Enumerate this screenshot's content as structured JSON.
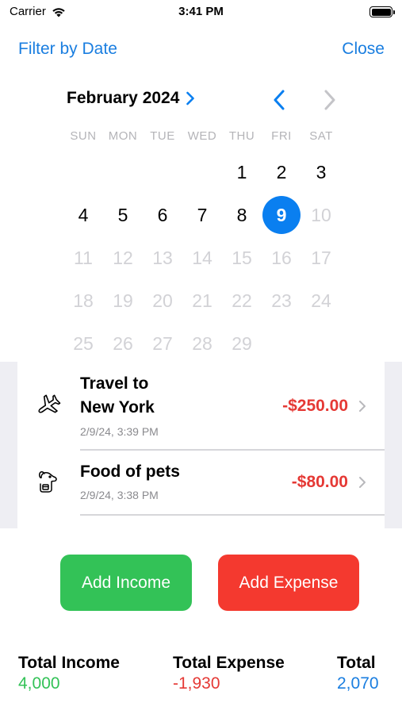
{
  "status_bar": {
    "carrier": "Carrier",
    "time": "3:41 PM"
  },
  "nav": {
    "left": "Filter by Date",
    "right": "Close"
  },
  "calendar": {
    "month_label": "February 2024",
    "weekdays": [
      "SUN",
      "MON",
      "TUE",
      "WED",
      "THU",
      "FRI",
      "SAT"
    ],
    "days": [
      {
        "label": "",
        "state": "empty"
      },
      {
        "label": "",
        "state": "empty"
      },
      {
        "label": "",
        "state": "empty"
      },
      {
        "label": "",
        "state": "empty"
      },
      {
        "label": "1",
        "state": "enabled"
      },
      {
        "label": "2",
        "state": "enabled"
      },
      {
        "label": "3",
        "state": "enabled"
      },
      {
        "label": "4",
        "state": "enabled"
      },
      {
        "label": "5",
        "state": "enabled"
      },
      {
        "label": "6",
        "state": "enabled"
      },
      {
        "label": "7",
        "state": "enabled"
      },
      {
        "label": "8",
        "state": "enabled"
      },
      {
        "label": "9",
        "state": "selected"
      },
      {
        "label": "10",
        "state": "disabled"
      },
      {
        "label": "11",
        "state": "disabled"
      },
      {
        "label": "12",
        "state": "disabled"
      },
      {
        "label": "13",
        "state": "disabled"
      },
      {
        "label": "14",
        "state": "disabled"
      },
      {
        "label": "15",
        "state": "disabled"
      },
      {
        "label": "16",
        "state": "disabled"
      },
      {
        "label": "17",
        "state": "disabled"
      },
      {
        "label": "18",
        "state": "disabled"
      },
      {
        "label": "19",
        "state": "disabled"
      },
      {
        "label": "20",
        "state": "disabled"
      },
      {
        "label": "21",
        "state": "disabled"
      },
      {
        "label": "22",
        "state": "disabled"
      },
      {
        "label": "23",
        "state": "disabled"
      },
      {
        "label": "24",
        "state": "disabled"
      },
      {
        "label": "25",
        "state": "disabled"
      },
      {
        "label": "26",
        "state": "disabled"
      },
      {
        "label": "27",
        "state": "disabled"
      },
      {
        "label": "28",
        "state": "disabled"
      },
      {
        "label": "29",
        "state": "disabled"
      }
    ]
  },
  "transactions": [
    {
      "title_line1": "Travel to",
      "title_line2": "New York",
      "timestamp": "2/9/24, 3:39 PM",
      "amount": "-$250.00",
      "icon": "airplane-icon"
    },
    {
      "title_line1": "Food of pets",
      "timestamp": "2/9/24, 3:38 PM",
      "amount": "-$80.00",
      "icon": "pet-icon"
    }
  ],
  "buttons": {
    "add_income": "Add Income",
    "add_expense": "Add Expense"
  },
  "totals": {
    "income_label": "Total Income",
    "income_value": "4,000",
    "expense_label": "Total Expense",
    "expense_value": "-1,930",
    "total_label": "Total",
    "total_value": "2,070"
  },
  "colors": {
    "accent": "#1a7ee0",
    "selected_day": "#0a7ff0",
    "income": "#33c257",
    "expense": "#f4392f",
    "total": "#1a7ee0",
    "amount_negative": "#e53935"
  }
}
